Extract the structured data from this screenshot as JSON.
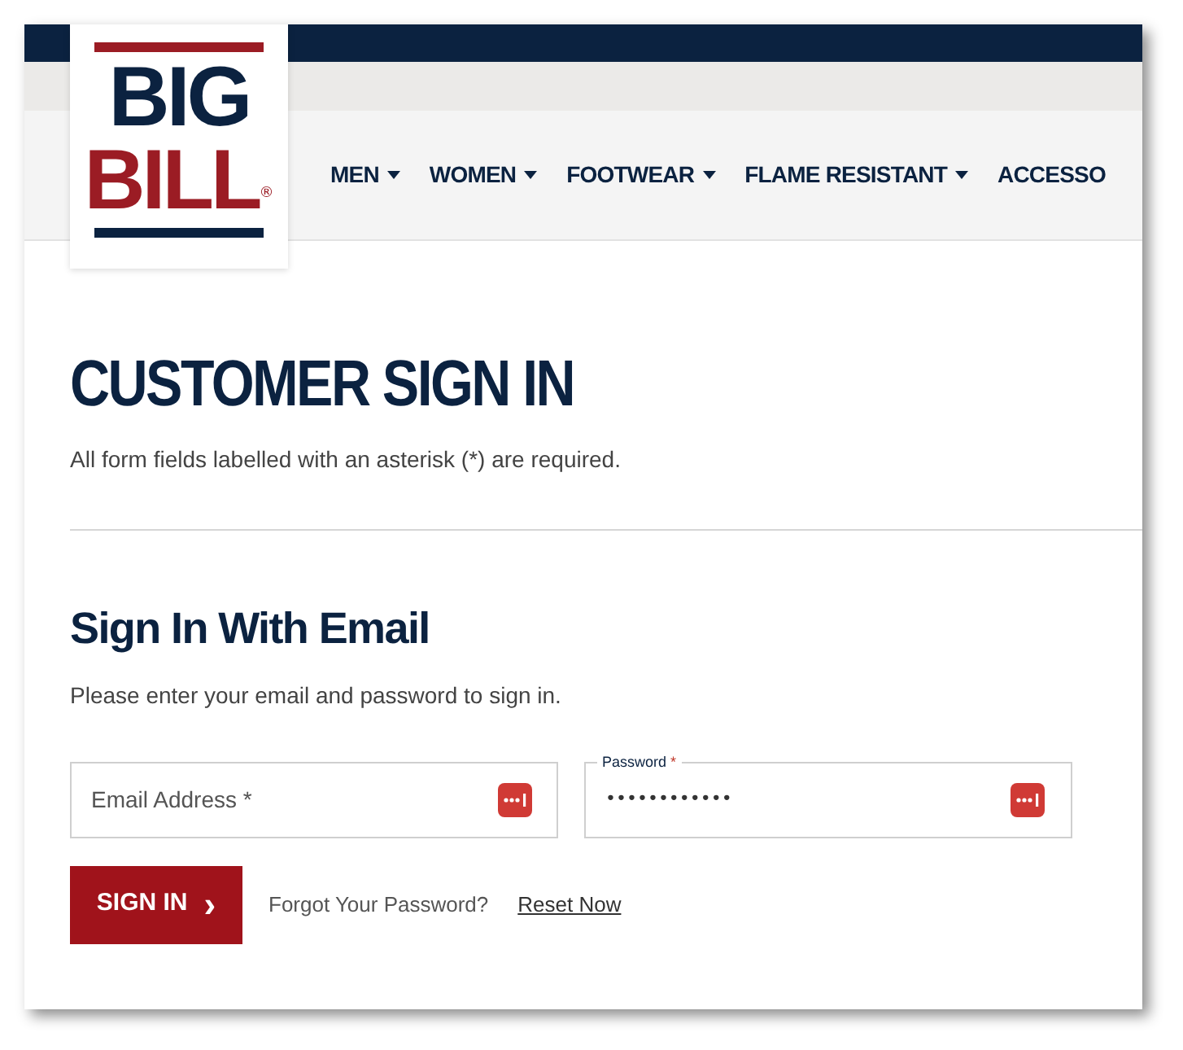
{
  "logo": {
    "line_1": "BIG",
    "line_2": "BILL",
    "mark": "®"
  },
  "nav": [
    {
      "label": "MEN",
      "dropdown": true
    },
    {
      "label": "WOMEN",
      "dropdown": true
    },
    {
      "label": "FOOTWEAR",
      "dropdown": true
    },
    {
      "label": "FLAME RESISTANT",
      "dropdown": true
    },
    {
      "label": "ACCESSO",
      "dropdown": false
    }
  ],
  "title": "CUSTOMER SIGN IN",
  "required_note": "All form fields labelled with an asterisk (*) are required.",
  "section_title": "Sign In With Email",
  "section_text": "Please enter your email and password to sign in.",
  "email": {
    "placeholder": "Email Address *"
  },
  "password": {
    "label": "Password",
    "required_mark": "*",
    "value": "••••••••••••"
  },
  "sign_in_button": {
    "label": "SIGN IN",
    "icon": "›"
  },
  "forgot_text": "Forgot Your Password?",
  "reset_link": "Reset Now"
}
